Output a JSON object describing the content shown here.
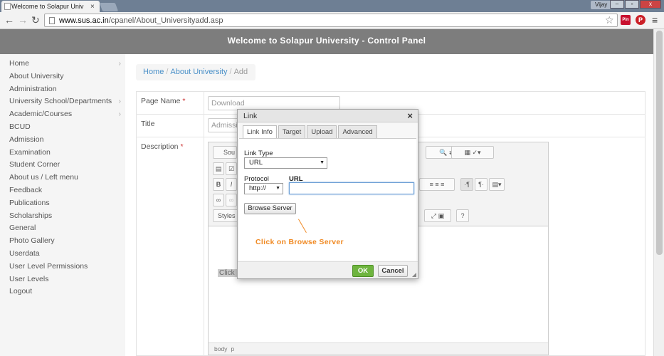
{
  "browser": {
    "tab_title": "Welcome to Solapur Univ",
    "tab_close": "×",
    "user_name": "Vijay",
    "url_host": "www.sus.ac.in",
    "url_path": "/cpanel/About_Universityadd.asp",
    "ext_pin_label": "Pin",
    "ext_pinterest_label": "P",
    "icons": [
      "back-arrow-icon",
      "forward-arrow-icon",
      "reload-icon",
      "star-icon",
      "menu-icon"
    ]
  },
  "header": {
    "title": "Welcome to Solapur University - Control Panel"
  },
  "sidebar": {
    "items": [
      {
        "label": "Home",
        "has_submenu": true
      },
      {
        "label": "About University",
        "has_submenu": false
      },
      {
        "label": "Administration",
        "has_submenu": false
      },
      {
        "label": "University School/Departments",
        "has_submenu": true
      },
      {
        "label": "Academic/Courses",
        "has_submenu": true
      },
      {
        "label": "BCUD",
        "has_submenu": false
      },
      {
        "label": "Admission",
        "has_submenu": false
      },
      {
        "label": "Examination",
        "has_submenu": false
      },
      {
        "label": "Student Corner",
        "has_submenu": false
      },
      {
        "label": "About us / Left menu",
        "has_submenu": false
      },
      {
        "label": "Feedback",
        "has_submenu": false
      },
      {
        "label": "Publications",
        "has_submenu": false
      },
      {
        "label": "Scholarships",
        "has_submenu": false
      },
      {
        "label": "General",
        "has_submenu": false
      },
      {
        "label": "Photo Gallery",
        "has_submenu": false
      },
      {
        "label": "Userdata",
        "has_submenu": false
      },
      {
        "label": "User Level Permissions",
        "has_submenu": false
      },
      {
        "label": "User Levels",
        "has_submenu": false
      },
      {
        "label": "Logout",
        "has_submenu": false
      }
    ]
  },
  "breadcrumb": {
    "home": "Home",
    "section": "About University",
    "current": "Add",
    "separator": "/"
  },
  "form": {
    "page_name_label": "Page Name",
    "page_name_value": "Download",
    "title_label": "Title",
    "title_value": "Admissi",
    "description_label": "Description",
    "required_marker": "*"
  },
  "editor": {
    "source_label": "Sou",
    "bold_label": "B",
    "italic_label": "I",
    "styles_label": "Styles",
    "help_label": "?",
    "body_hint": "Click h",
    "status_path": [
      "body",
      "p"
    ]
  },
  "dialog": {
    "title": "Link",
    "close_label": "×",
    "tabs": [
      {
        "label": "Link Info",
        "active": true
      },
      {
        "label": "Target",
        "active": false
      },
      {
        "label": "Upload",
        "active": false
      },
      {
        "label": "Advanced",
        "active": false
      }
    ],
    "link_type_label": "Link Type",
    "link_type_value": "URL",
    "protocol_label": "Protocol",
    "protocol_value": "http://",
    "url_label": "URL",
    "url_value": "",
    "browse_label": "Browse Server",
    "annotation": "Click on Browse Server",
    "ok_label": "OK",
    "cancel_label": "Cancel",
    "annotation_color": "#f08a24",
    "ok_color": "#6eb43e"
  }
}
